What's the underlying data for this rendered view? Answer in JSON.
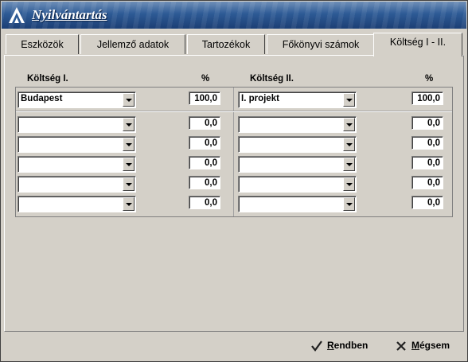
{
  "window": {
    "title": "Nyilvántartás"
  },
  "tabs": [
    {
      "label": "Eszközök"
    },
    {
      "label": "Jellemző adatok"
    },
    {
      "label": "Tartozékok"
    },
    {
      "label": "Főkönyvi számok"
    },
    {
      "label": "Költség I - II."
    }
  ],
  "active_tab": "Költség I - II.",
  "columns": {
    "left": {
      "header": "Költség I.",
      "pct_header": "%"
    },
    "right": {
      "header": "Költség II.",
      "pct_header": "%"
    }
  },
  "rows": [
    {
      "left_value": "Budapest",
      "left_pct": "100,0",
      "right_value": "I. projekt",
      "right_pct": "100,0"
    },
    {
      "left_value": "",
      "left_pct": "0,0",
      "right_value": "",
      "right_pct": "0,0"
    },
    {
      "left_value": "",
      "left_pct": "0,0",
      "right_value": "",
      "right_pct": "0,0"
    },
    {
      "left_value": "",
      "left_pct": "0,0",
      "right_value": "",
      "right_pct": "0,0"
    },
    {
      "left_value": "",
      "left_pct": "0,0",
      "right_value": "",
      "right_pct": "0,0"
    },
    {
      "left_value": "",
      "left_pct": "0,0",
      "right_value": "",
      "right_pct": "0,0"
    }
  ],
  "buttons": {
    "ok": {
      "label": "Rendben",
      "icon": "checkmark-icon",
      "color": "#202020"
    },
    "cancel": {
      "label": "Mégsem",
      "icon": "x-icon",
      "color": "#202020"
    }
  },
  "colors": {
    "title_bar": "#2d5a95",
    "face": "#d4d0c8"
  }
}
